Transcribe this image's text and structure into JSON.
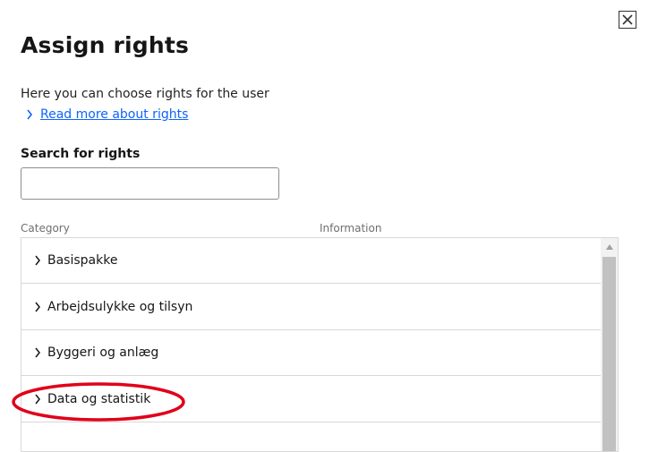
{
  "dialog": {
    "title": "Assign rights",
    "description": "Here you can choose rights for the user",
    "read_more_link": "Read more about rights",
    "search_label": "Search for rights",
    "search_value": ""
  },
  "table": {
    "columns": [
      "Category",
      "Information"
    ],
    "rows": [
      {
        "label": "Basispakke"
      },
      {
        "label": "Arbejdsulykke og tilsyn"
      },
      {
        "label": "Byggeri og anlæg"
      },
      {
        "label": "Data og statistik"
      }
    ]
  },
  "icons": {
    "close": "close-icon",
    "row_expand": "chevron-right-icon",
    "link": "chevron-right-icon",
    "scroll_up": "arrow-up-icon"
  },
  "colors": {
    "link": "#0f62fe",
    "annotation": "#e0001a",
    "scroll_thumb": "#c1c1c1"
  }
}
